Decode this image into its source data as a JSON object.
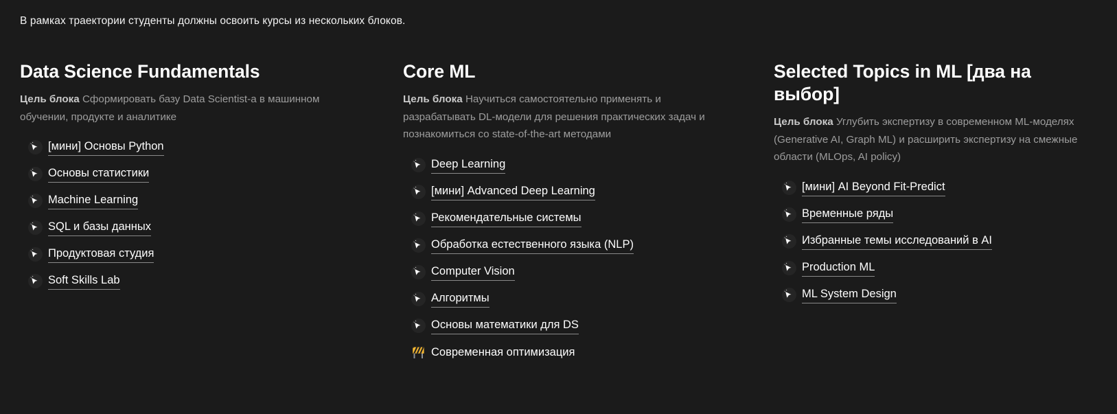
{
  "intro": "В рамках траектории студенты должны освоить курсы из нескольких блоков.",
  "goal_label": "Цель блока",
  "colors": {
    "background": "#1b1b1b",
    "text": "#fdfdfd",
    "muted": "#9d9d9d",
    "underline": "#8a8a8a",
    "icon_circle": "#252525",
    "construction_yellow": "#f5b731"
  },
  "columns": [
    {
      "title": "Data Science Fundamentals",
      "goal_label": "Цель блока",
      "goal_text": "Сформировать базу Data Scientist-a в машинном обучении, продукте и аналитике",
      "items": [
        {
          "label": "[мини] Основы Python",
          "icon": "cursor-click-icon",
          "link": true
        },
        {
          "label": "Основы статистики",
          "icon": "cursor-click-icon",
          "link": true
        },
        {
          "label": "Machine Learning",
          "icon": "cursor-click-icon",
          "link": true
        },
        {
          "label": "SQL и базы данных",
          "icon": "cursor-click-icon",
          "link": true
        },
        {
          "label": "Продуктовая студия",
          "icon": "cursor-click-icon",
          "link": true
        },
        {
          "label": "Soft Skills Lab",
          "icon": "cursor-click-icon",
          "link": true
        }
      ]
    },
    {
      "title": "Core ML",
      "goal_label": "Цель блока",
      "goal_text": "Научиться самостоятельно применять и разрабатывать DL-модели для решения практических задач и познакомиться со state-of-the-art методами",
      "items": [
        {
          "label": "Deep Learning",
          "icon": "cursor-click-icon",
          "link": true
        },
        {
          "label": "[мини] Advanced Deep Learning",
          "icon": "cursor-click-icon",
          "link": true
        },
        {
          "label": "Рекомендательные системы",
          "icon": "cursor-click-icon",
          "link": true
        },
        {
          "label": "Обработка естественного языка (NLP)",
          "icon": "cursor-click-icon",
          "link": true
        },
        {
          "label": "Computer Vision",
          "icon": "cursor-click-icon",
          "link": true
        },
        {
          "label": "Алгоритмы",
          "icon": "cursor-click-icon",
          "link": true
        },
        {
          "label": "Основы математики для DS",
          "icon": "cursor-click-icon",
          "link": true
        },
        {
          "label": "Современная оптимизация",
          "icon": "construction-icon",
          "link": false
        }
      ]
    },
    {
      "title": "Selected Topics in ML [два на выбор]",
      "goal_label": "Цель блока",
      "goal_text": "Углубить экспертизу в современном ML-моделях (Generative AI, Graph ML) и расширить экспертизу на смежные области (MLOps, AI policy)",
      "items": [
        {
          "label": "[мини] AI Beyond Fit-Predict",
          "icon": "cursor-click-icon",
          "link": true
        },
        {
          "label": "Временные ряды",
          "icon": "cursor-click-icon",
          "link": true
        },
        {
          "label": "Избранные темы исследований в AI",
          "icon": "cursor-click-icon",
          "link": true
        },
        {
          "label": "Production ML",
          "icon": "cursor-click-icon",
          "link": true
        },
        {
          "label": "ML System Design",
          "icon": "cursor-click-icon",
          "link": true
        }
      ]
    }
  ]
}
